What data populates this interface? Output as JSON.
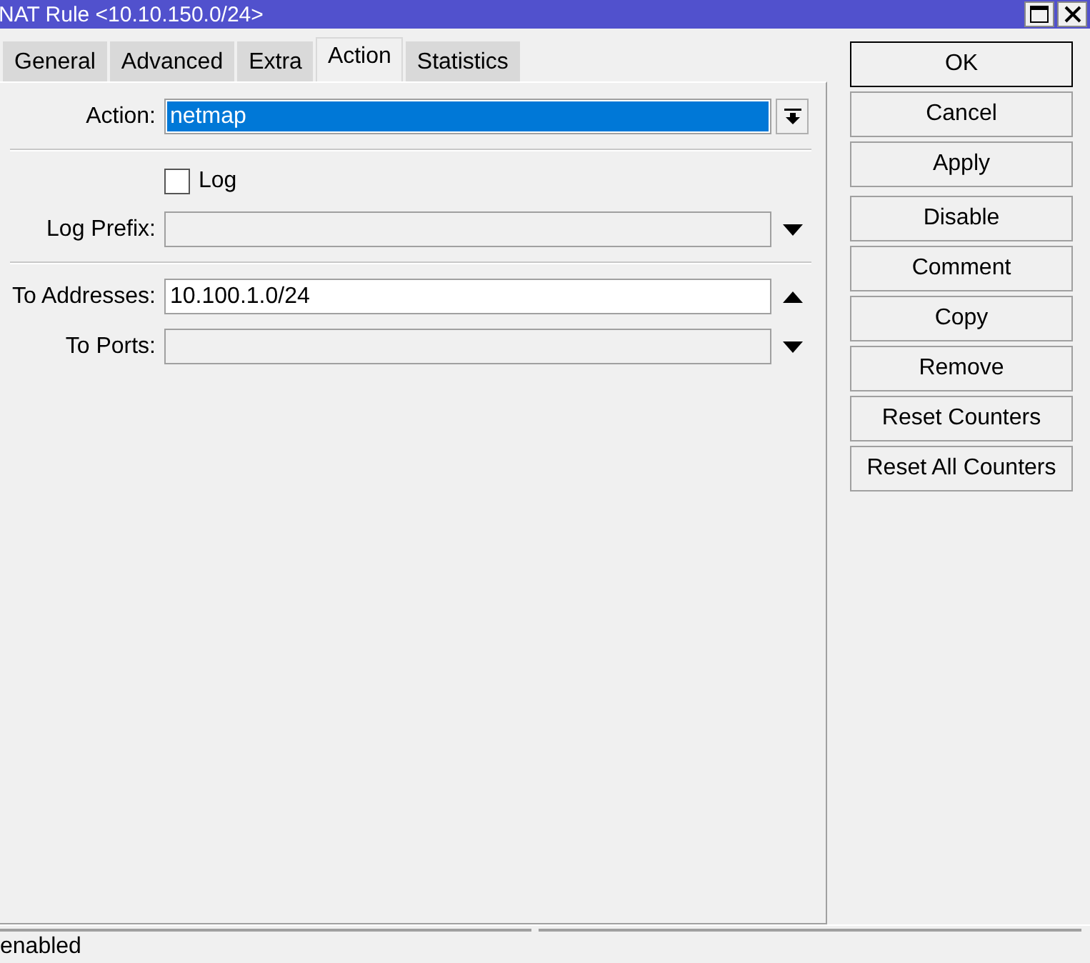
{
  "window": {
    "title": "NAT Rule <10.10.150.0/24>"
  },
  "tabs": [
    {
      "label": "General",
      "selected": false
    },
    {
      "label": "Advanced",
      "selected": false
    },
    {
      "label": "Extra",
      "selected": false
    },
    {
      "label": "Action",
      "selected": true
    },
    {
      "label": "Statistics",
      "selected": false
    }
  ],
  "rows": [
    {
      "kind": "select",
      "label": "Action:",
      "value": "netmap"
    },
    {
      "kind": "separator"
    },
    {
      "kind": "checkbox",
      "label": "Log",
      "checked": false
    },
    {
      "kind": "combo",
      "label": "Log Prefix:",
      "expanded": false
    },
    {
      "kind": "separator"
    },
    {
      "kind": "combo",
      "label": "To Addresses:",
      "value": "10.100.1.0/24",
      "expanded": true
    },
    {
      "kind": "combo",
      "label": "To Ports:",
      "expanded": false
    }
  ],
  "button_groups": [
    [
      {
        "label": "OK",
        "focused": true
      },
      {
        "label": "Cancel",
        "focused": false
      },
      {
        "label": "Apply",
        "focused": false
      }
    ],
    [
      {
        "label": "Disable",
        "focused": false
      },
      {
        "label": "Comment",
        "focused": false
      },
      {
        "label": "Copy",
        "focused": false
      },
      {
        "label": "Remove",
        "focused": false
      },
      {
        "label": "Reset Counters",
        "focused": false
      },
      {
        "label": "Reset All Counters",
        "focused": false
      }
    ]
  ],
  "status_bar": {
    "text": "enabled"
  }
}
